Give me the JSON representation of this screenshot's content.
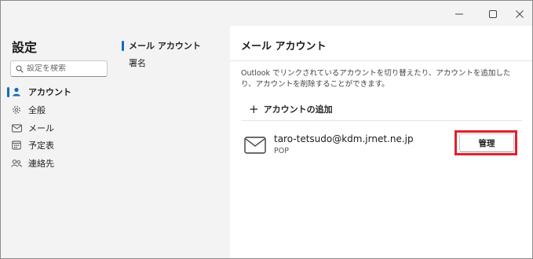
{
  "window": {
    "controls": {
      "minimize_icon": "minimize-icon",
      "maximize_icon": "maximize-icon",
      "close_icon": "close-icon"
    }
  },
  "settings": {
    "title": "設定",
    "search": {
      "placeholder": "設定を検索",
      "value": ""
    },
    "nav": [
      {
        "label": "アカウント",
        "icon": "person-icon",
        "selected": true
      },
      {
        "label": "全般",
        "icon": "gear-icon",
        "selected": false
      },
      {
        "label": "メール",
        "icon": "mail-icon",
        "selected": false
      },
      {
        "label": "予定表",
        "icon": "calendar-icon",
        "selected": false
      },
      {
        "label": "連絡先",
        "icon": "people-icon",
        "selected": false
      }
    ]
  },
  "subnav": [
    {
      "label": "メール アカウント",
      "selected": true
    },
    {
      "label": "署名",
      "selected": false
    }
  ],
  "content": {
    "title": "メール アカウント",
    "description": "Outlook でリンクされているアカウントを切り替えたり、アカウントを追加したり、アカウントを削除することができます。",
    "add_account_label": "アカウントの追加",
    "accounts": [
      {
        "email": "taro-tetsudo@kdm.jrnet.ne.jp",
        "type": "POP",
        "manage_label": "管理"
      }
    ]
  },
  "colors": {
    "accent": "#0f6cbd",
    "highlight": "#e0202e"
  }
}
